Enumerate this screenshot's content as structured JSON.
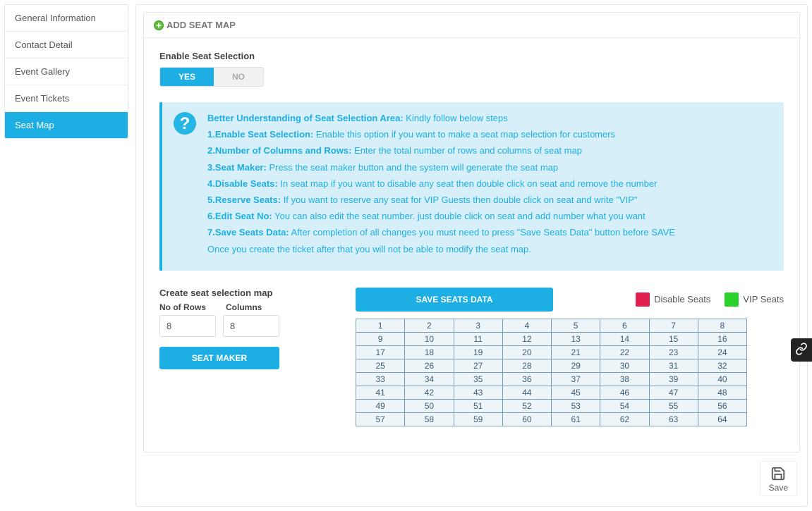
{
  "sidebar": {
    "items": [
      {
        "label": "General Information"
      },
      {
        "label": "Contact Detail"
      },
      {
        "label": "Event Gallery"
      },
      {
        "label": "Event Tickets"
      },
      {
        "label": "Seat Map"
      }
    ],
    "active_index": 4
  },
  "card": {
    "title": "ADD SEAT MAP"
  },
  "enable": {
    "label": "Enable Seat Selection",
    "yes": "YES",
    "no": "NO"
  },
  "info": {
    "header_bold": "Better Understanding of Seat Selection Area:",
    "header_rest": " Kindly follow below steps",
    "steps": [
      {
        "bold": "1.Enable Seat Selection:",
        "text": " Enable this option if you want to make a seat map selection for customers"
      },
      {
        "bold": "2.Number of Columns and Rows:",
        "text": " Enter the total number of rows and columns of seat map"
      },
      {
        "bold": "3.Seat Maker:",
        "text": " Press the seat maker button and the system will generate the seat map"
      },
      {
        "bold": "4.Disable Seats:",
        "text": " In seat map if you want to disable any seat then double click on seat and remove the number"
      },
      {
        "bold": "5.Reserve Seats:",
        "text": " If you want to reserve any seat for VIP Guests then double click on seat and write \"VIP\""
      },
      {
        "bold": "6.Edit Seat No:",
        "text": " You can also edit the seat number. just double click on seat and add number what you want"
      },
      {
        "bold": "7.Save Seats Data:",
        "text": " After completion of all changes you must need to press \"Save Seats Data\" button before SAVE"
      }
    ],
    "footer": "Once you create the ticket after that you will not be able to modify the seat map."
  },
  "create": {
    "heading": "Create seat selection map",
    "rows_label": "No of Rows",
    "cols_label": "Columns",
    "rows_value": "8",
    "cols_value": "8",
    "button": "SEAT MAKER"
  },
  "seats": {
    "save_button": "SAVE SEATS DATA",
    "legend_disable": "Disable Seats",
    "legend_vip": "VIP Seats",
    "rows": 8,
    "cols": 8
  },
  "footer": {
    "save": "Save"
  },
  "colors": {
    "accent": "#1daee3",
    "disable": "#e22050",
    "vip": "#2ad12a"
  }
}
